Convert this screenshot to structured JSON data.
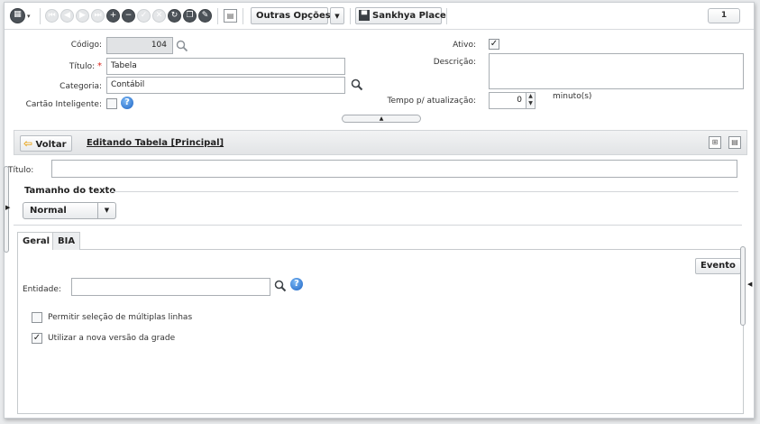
{
  "toolbar": {
    "outras_opcoes_label": "Outras Opções...",
    "sankhya_place_label": "Sankhya Place",
    "page_number": "1"
  },
  "form": {
    "codigo": {
      "label": "Código:",
      "value": "104"
    },
    "titulo": {
      "label": "Título:",
      "required_mark": "*",
      "value": "Tabela"
    },
    "categoria": {
      "label": "Categoria:",
      "value": "Contábil"
    },
    "cartao": {
      "label": "Cartão Inteligente:"
    },
    "ativo": {
      "label": "Ativo:",
      "checked": true
    },
    "descricao": {
      "label": "Descrição:",
      "value": ""
    },
    "tempo": {
      "label": "Tempo p/ atualização:",
      "value": "0",
      "unit": "minuto(s)"
    }
  },
  "subbar": {
    "voltar_label": "Voltar",
    "editing_title": "Editando Tabela [Principal]"
  },
  "detail": {
    "titulo_label": "Título:",
    "titulo_value": "",
    "tamanho_title": "Tamanho do texto",
    "tamanho_value": "Normal"
  },
  "tabs": [
    {
      "label": "Geral",
      "active": true
    },
    {
      "label": "BIA",
      "active": false
    }
  ],
  "geral": {
    "evento_label": "Evento",
    "entidade_label": "Entidade:",
    "entidade_value": "",
    "multi_select_label": "Permitir seleção de múltiplas linhas",
    "multi_select_checked": false,
    "nova_grade_label": "Utilizar a nova versão da grade",
    "nova_grade_checked": true
  },
  "colors": {
    "accent": "#1e64c4",
    "required": "#d9251c",
    "back_arrow": "#e8a417"
  }
}
